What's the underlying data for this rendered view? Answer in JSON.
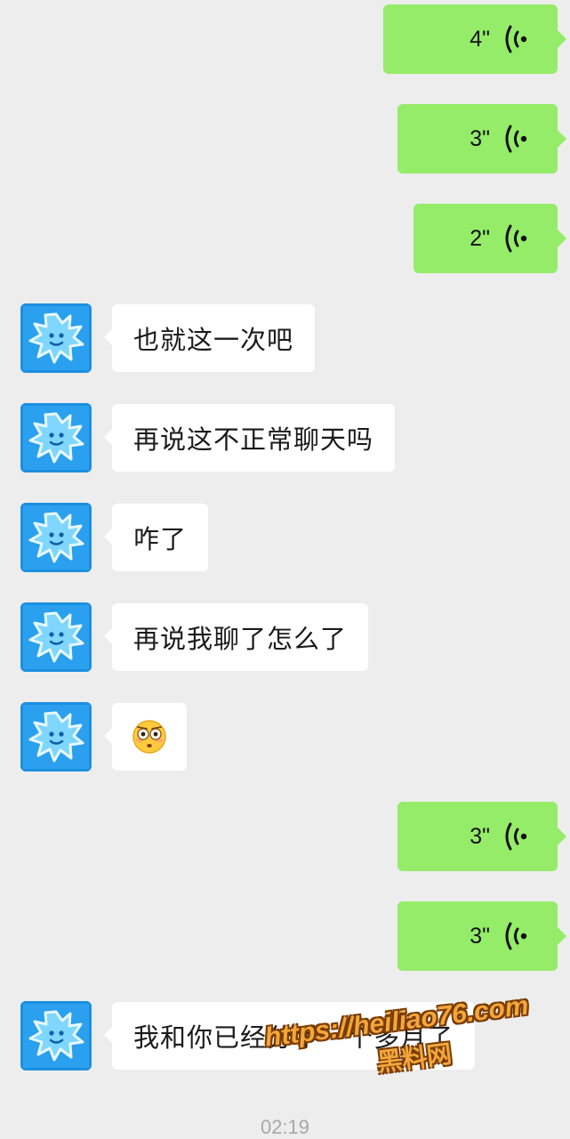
{
  "messages": [
    {
      "side": "out",
      "type": "voice",
      "duration": "4\""
    },
    {
      "side": "out",
      "type": "voice",
      "duration": "3\""
    },
    {
      "side": "out",
      "type": "voice",
      "duration": "2\""
    },
    {
      "side": "in",
      "type": "text",
      "text": "也就这一次吧"
    },
    {
      "side": "in",
      "type": "text",
      "text": "再说这不正常聊天吗"
    },
    {
      "side": "in",
      "type": "text",
      "text": "咋了"
    },
    {
      "side": "in",
      "type": "text",
      "text": "再说我聊了怎么了"
    },
    {
      "side": "in",
      "type": "emoji",
      "emoji": "flushed-face-emoji"
    },
    {
      "side": "out",
      "type": "voice",
      "duration": "3\""
    },
    {
      "side": "out",
      "type": "voice",
      "duration": "3\""
    },
    {
      "side": "in",
      "type": "text",
      "text": "我和你已经分手一个多月了"
    }
  ],
  "timestamp": "02:19",
  "watermark": {
    "url": "https://heiliao76.com",
    "name": "黑料网"
  },
  "icons": {
    "voice": "voice-wave-icon",
    "avatar": "blue-star-creature-avatar"
  },
  "colors": {
    "background": "#ededed",
    "outgoing_bubble": "#95ec69",
    "incoming_bubble": "#ffffff",
    "avatar_bg": "#1c8fe0",
    "watermark": "#f3a63c"
  }
}
